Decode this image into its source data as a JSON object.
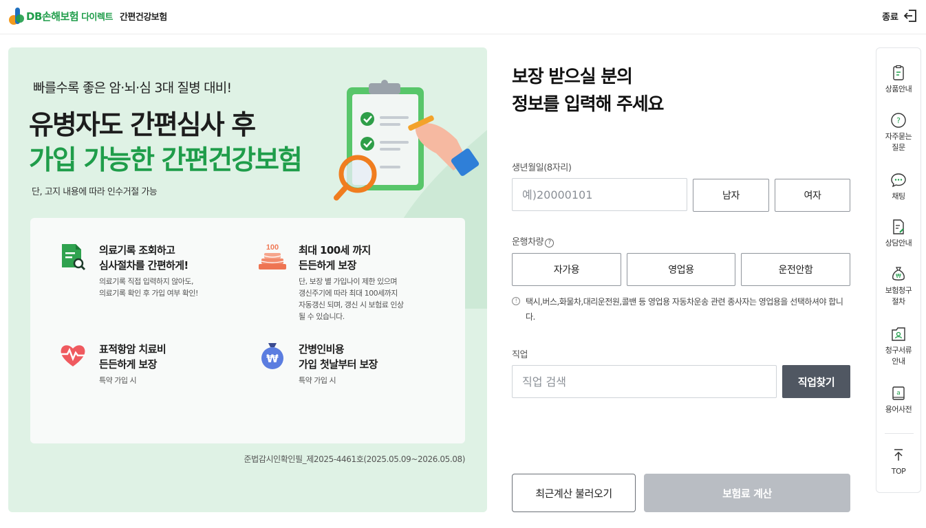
{
  "header": {
    "brand": "DB손해보험",
    "brand_sub": "다이렉트",
    "product": "간편건강보험",
    "exit_label": "종료"
  },
  "banner": {
    "subtitle": "빠를수록 좋은 암·뇌·심 3대 질병 대비!",
    "title_line1": "유병자도 간편심사 후",
    "title_line2": "가입 가능한 간편건강보험",
    "note": "단, 고지 내용에 따라 인수거절 가능",
    "features": [
      {
        "icon": "document-search-icon",
        "title": "의료기록 조회하고\n심사절차를 간편하게!",
        "desc": "의료기록 직접 입력하지 않아도,\n의료기록 확인 후 가입 여부 확인!"
      },
      {
        "icon": "cake-100-icon",
        "icon_text": "100",
        "title": "최대 100세 까지\n든든하게 보장",
        "desc": "단, 보장 별 가입나이 제한 있으며\n갱신주기에 따라 최대 100세까지\n자동갱신 되며, 갱신 시 보험료 인상\n될 수 있습니다."
      },
      {
        "icon": "heart-pulse-icon",
        "title": "표적항암 치료비\n든든하게 보장",
        "desc": "특약 가입 시"
      },
      {
        "icon": "money-bag-icon",
        "icon_text": "₩",
        "title": "간병인비용\n가입 첫날부터 보장",
        "desc": "특약 가입 시"
      }
    ],
    "approval": "준법감시인확인필_제2025-4461호(2025.05.09~2026.05.08)"
  },
  "form": {
    "title": "보장 받으실 분의\n정보를 입력해 주세요",
    "birth_label": "생년월일(8자리)",
    "birth_placeholder": "예)20000101",
    "gender_male": "남자",
    "gender_female": "여자",
    "vehicle_label": "운행차량",
    "vehicle_options": [
      "자가용",
      "영업용",
      "운전안함"
    ],
    "vehicle_notice": "택시,버스,화물차,대리운전원,콜밴 등 영업용 자동차운송 관련 종사자는 영업용을 선택하셔야 합니다.",
    "job_label": "직업",
    "job_placeholder": "직업 검색",
    "job_button": "직업찾기",
    "recent_button": "최근계산 불러오기",
    "calc_button": "보험료 계산"
  },
  "quick_menu": {
    "items": [
      {
        "label": "상품안내",
        "icon": "product-info-icon"
      },
      {
        "label": "자주묻는\n질문",
        "icon": "faq-icon"
      },
      {
        "label": "채팅",
        "icon": "chat-icon"
      },
      {
        "label": "상담안내",
        "icon": "consult-icon"
      },
      {
        "label": "보험청구\n절차",
        "icon": "claim-process-icon"
      },
      {
        "label": "청구서류\n안내",
        "icon": "claim-docs-icon"
      },
      {
        "label": "용어사전",
        "icon": "dictionary-icon"
      }
    ],
    "top_label": "TOP"
  },
  "colors": {
    "brand_green": "#1f9d4a",
    "banner_bg": "#dff2e5",
    "job_button_bg": "#505762",
    "calc_button_bg": "#b9bdc3"
  }
}
